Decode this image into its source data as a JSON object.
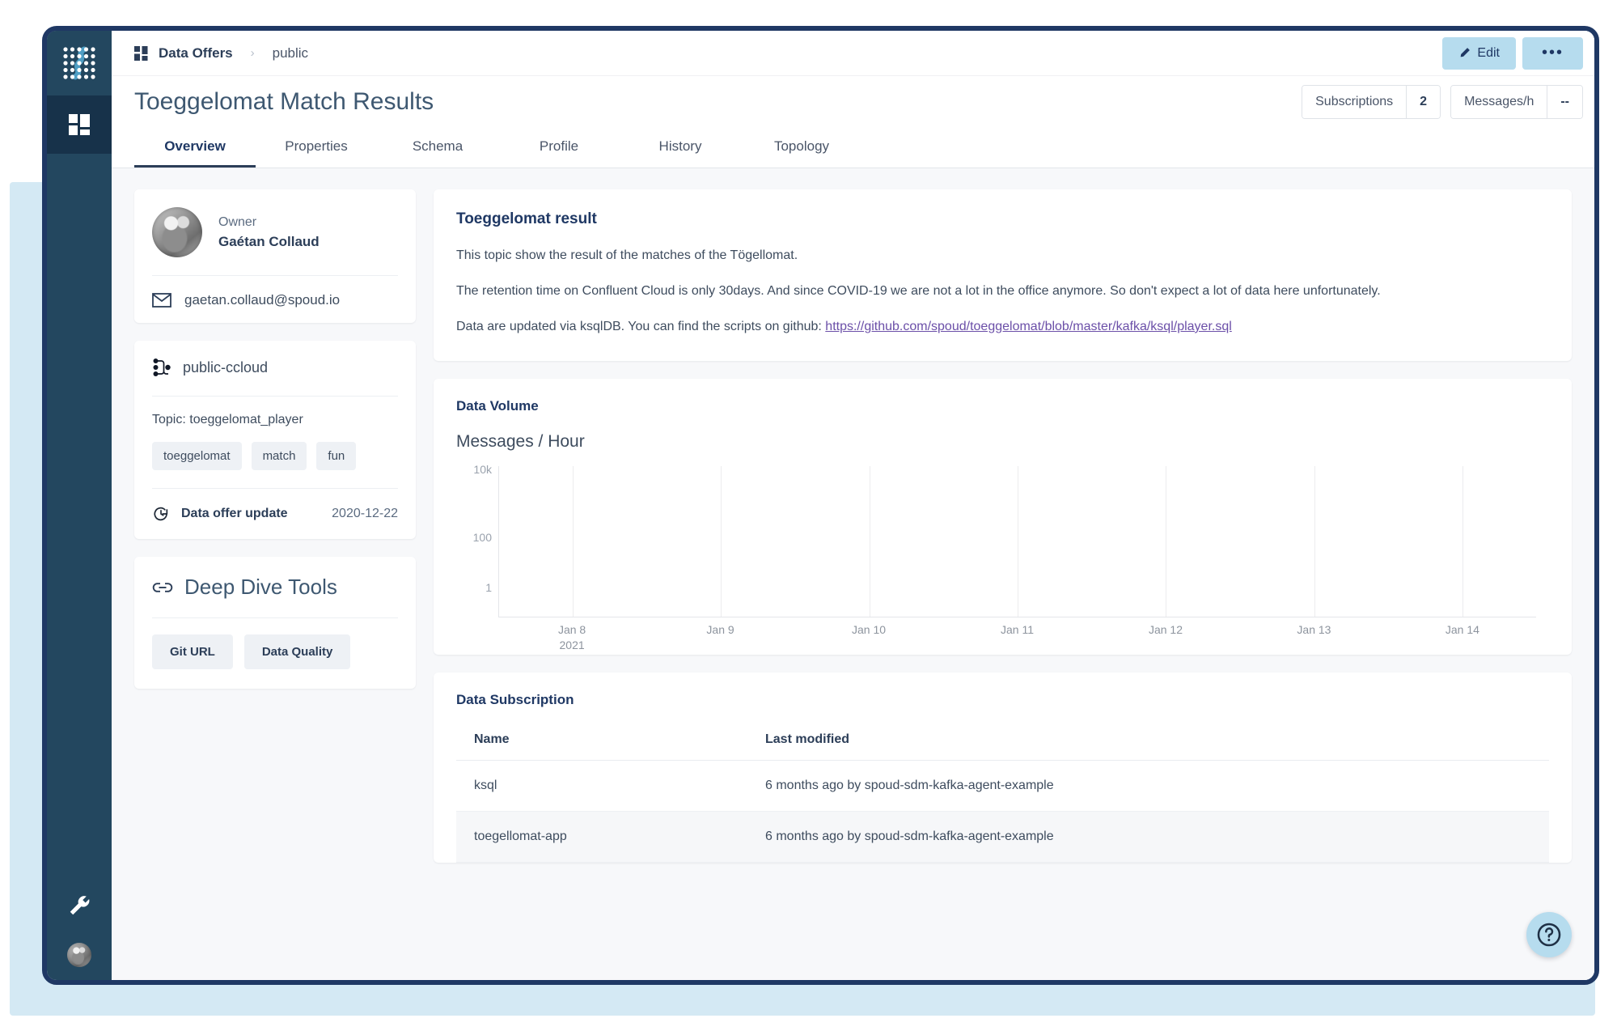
{
  "sidebar": {
    "logo_icon": "spoud-dot-matrix-logo",
    "items": [
      {
        "icon": "dashboard-grid-icon",
        "active": true
      }
    ],
    "bottom": [
      {
        "icon": "wrench-icon"
      },
      {
        "icon": "user-avatar"
      }
    ]
  },
  "topbar": {
    "breadcrumb_icon": "grid-icon",
    "breadcrumb_root": "Data Offers",
    "breadcrumb_separator": "›",
    "breadcrumb_current": "public",
    "edit_label": "Edit",
    "edit_icon": "pencil-icon",
    "more_label": "•••"
  },
  "header": {
    "title": "Toeggelomat Match Results",
    "stats": [
      {
        "label": "Subscriptions",
        "value": "2"
      },
      {
        "label": "Messages/h",
        "value": "--"
      }
    ]
  },
  "tabs": [
    {
      "label": "Overview",
      "active": true
    },
    {
      "label": "Properties",
      "active": false
    },
    {
      "label": "Schema",
      "active": false
    },
    {
      "label": "Profile",
      "active": false
    },
    {
      "label": "History",
      "active": false
    },
    {
      "label": "Topology",
      "active": false
    }
  ],
  "owner_card": {
    "avatar_icon": "owner-avatar",
    "label": "Owner",
    "name": "Gaétan Collaud",
    "email_icon": "envelope-icon",
    "email": "gaetan.collaud@spoud.io"
  },
  "cluster_card": {
    "cluster_icon": "kafka-cluster-icon",
    "cluster_name": "public-ccloud",
    "topic": "Topic: toeggelomat_player",
    "tags": [
      "toeggelomat",
      "match",
      "fun"
    ],
    "update_icon": "refresh-clock-icon",
    "update_label": "Data offer update",
    "update_date": "2020-12-22"
  },
  "deep_dive": {
    "link_icon": "link-icon",
    "title": "Deep Dive Tools",
    "buttons": [
      "Git URL",
      "Data Quality"
    ]
  },
  "description": {
    "title": "Toeggelomat result",
    "paragraph1": "This topic show the result of the matches of the Tögellomat.",
    "paragraph2": "The retention time on Confluent Cloud is only 30days. And since COVID-19 we are not a lot in the office anymore. So don't expect a lot of data here unfortunately.",
    "paragraph3_prefix": "Data are updated via ksqlDB. You can find the scripts on github: ",
    "link_text": "https://github.com/spoud/toeggelomat/blob/master/kafka/ksql/player.sql"
  },
  "data_volume": {
    "section_title": "Data Volume",
    "subtitle": "Messages / Hour"
  },
  "chart_data": {
    "type": "line",
    "title": "Messages / Hour",
    "xlabel": "",
    "ylabel": "",
    "yscale": "log",
    "yticks": [
      "1",
      "100",
      "10k"
    ],
    "ytick_values": [
      1,
      100,
      10000
    ],
    "ylim": [
      1,
      10000
    ],
    "categories": [
      "Jan 8",
      "Jan 9",
      "Jan 10",
      "Jan 11",
      "Jan 12",
      "Jan 13",
      "Jan 14"
    ],
    "x_sublabel": "2021",
    "series": [
      {
        "name": "Messages / Hour",
        "values": [
          null,
          null,
          null,
          null,
          null,
          null,
          null
        ]
      }
    ],
    "grid": true,
    "legend": false,
    "note": "no data plotted; chart area is empty"
  },
  "subscription": {
    "section_title": "Data Subscription",
    "columns": [
      "Name",
      "Last modified"
    ],
    "rows": [
      {
        "name": "ksql",
        "modified": "6 months ago by spoud-sdm-kafka-agent-example"
      },
      {
        "name": "toegellomat-app",
        "modified": "6 months ago by spoud-sdm-kafka-agent-example"
      }
    ]
  },
  "help": {
    "icon": "question-circle-icon"
  },
  "colors": {
    "sidebar": "#23475f",
    "window_border": "#1f3864",
    "accent_blue": "#b6dcee",
    "bg_panel": "#d4e9f4",
    "link_purple": "#6b4fa8"
  }
}
